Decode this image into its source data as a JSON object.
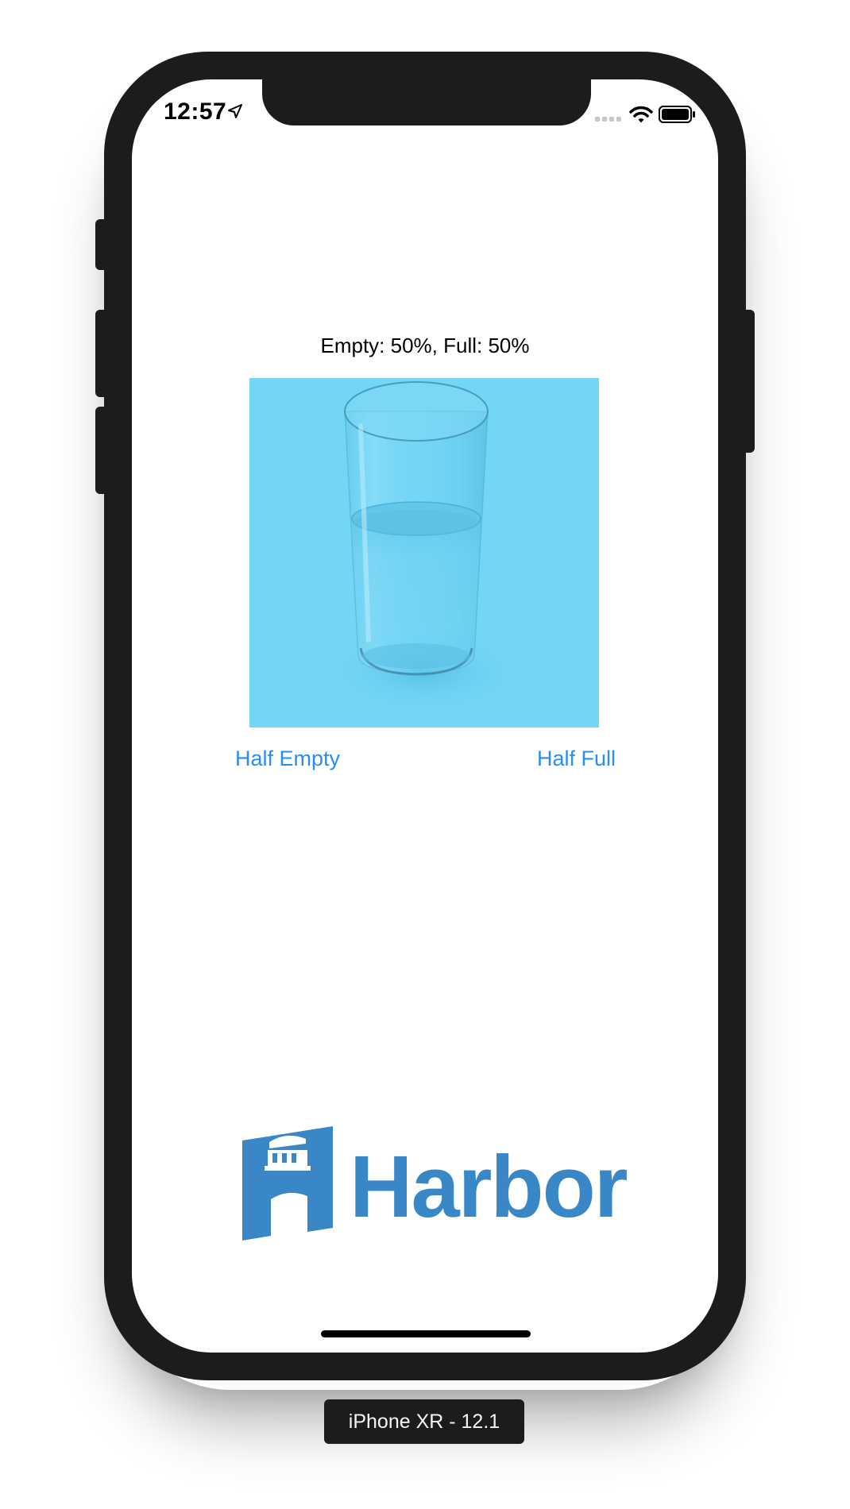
{
  "status_bar": {
    "time": "12:57",
    "location_icon": "location-arrow-icon",
    "signal_icon": "cellular-signal-icon",
    "wifi_icon": "wifi-icon",
    "battery_icon": "battery-icon"
  },
  "main": {
    "counts_text": "Empty: 50%, Full: 50%",
    "glass": {
      "image": "half-filled-water-glass",
      "background_color": "#74d6f5",
      "fill_level": 0.5
    },
    "half_empty_label": "Half Empty",
    "half_full_label": "Half Full"
  },
  "logo": {
    "text": "Harbor",
    "color": "#3a87c8"
  },
  "device_label": "iPhone XR - 12.1",
  "colors": {
    "link": "#2a8df4",
    "device_frame": "#1c1c1c"
  }
}
